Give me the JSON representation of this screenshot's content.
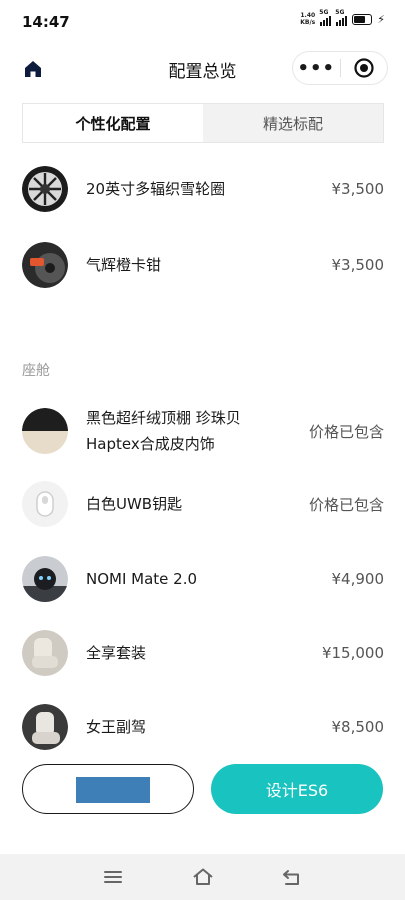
{
  "status_bar": {
    "time": "14:47",
    "net_speed_value": "1.40",
    "net_speed_unit": "KB/s",
    "signal_1": "5G",
    "signal_2": "5G"
  },
  "nav": {
    "title": "配置总览",
    "more": "•••"
  },
  "tabs": [
    {
      "label": "个性化配置",
      "active": true
    },
    {
      "label": "精选标配",
      "active": false
    }
  ],
  "items_top": [
    {
      "name": "20英寸多辐织雪轮圈",
      "price": "¥3,500"
    },
    {
      "name": "气辉橙卡钳",
      "price": "¥3,500"
    }
  ],
  "section_cabin": {
    "label": "座舱"
  },
  "items_cabin": [
    {
      "name_line1": "黑色超纤绒顶棚 珍珠贝",
      "name_line2": "Haptex合成皮内饰",
      "price": "价格已包含"
    },
    {
      "name": "白色UWB钥匙",
      "price": "价格已包含"
    },
    {
      "name": "NOMI Mate 2.0",
      "price": "¥4,900"
    },
    {
      "name": "全享套装",
      "price": "¥15,000"
    },
    {
      "name": "女王副驾",
      "price": "¥8,500"
    }
  ],
  "actions": {
    "primary": "设计ES6"
  },
  "colors": {
    "accent": "#19c3bf",
    "redaction": "#3e7fb8"
  }
}
